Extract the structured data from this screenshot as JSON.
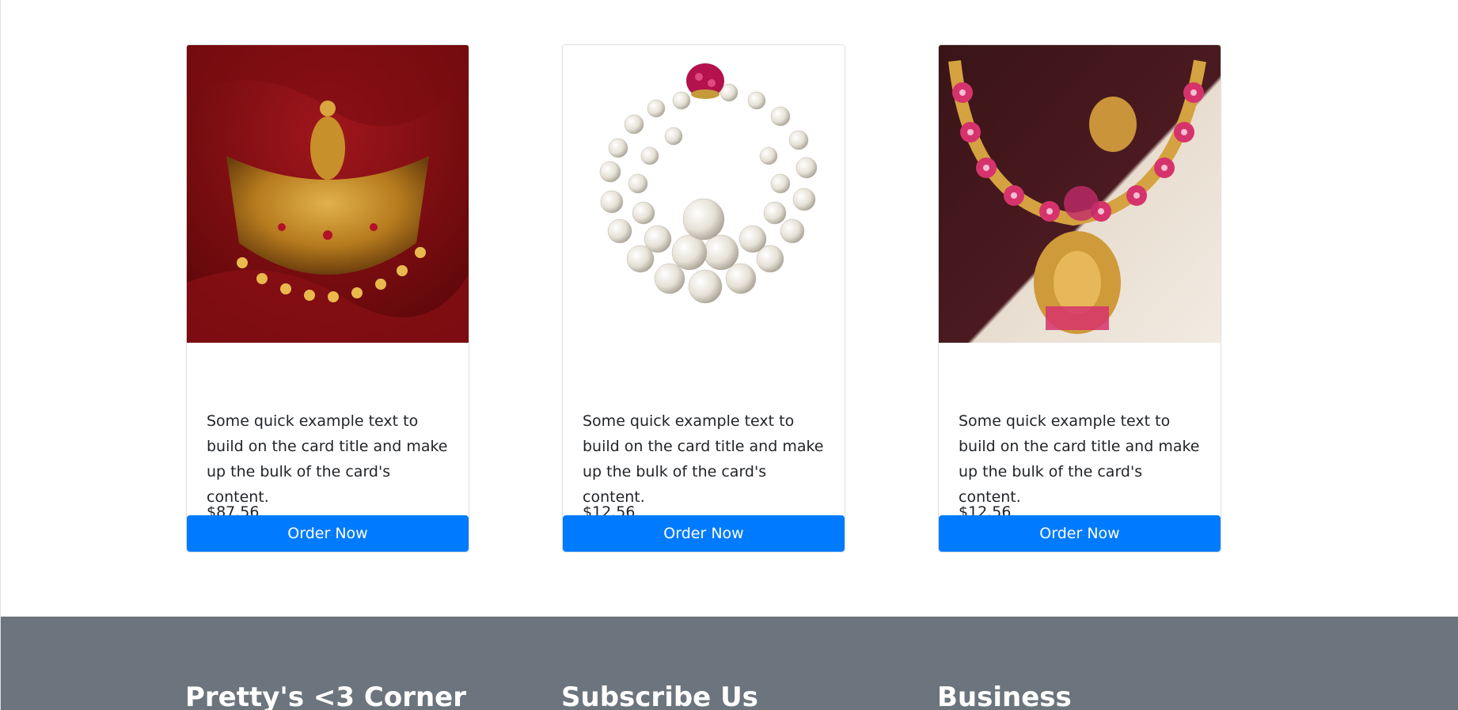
{
  "products": [
    {
      "image_alt": "gold-bridal-necklace",
      "description": "Some quick example text to build on the card title and make up the bulk of the card's content.",
      "price": "$87.56",
      "button_label": "Order Now"
    },
    {
      "image_alt": "pearl-necklace",
      "description": "Some quick example text to build on the card title and make up the bulk of the card's content.",
      "price": "$12.56",
      "button_label": "Order Now"
    },
    {
      "image_alt": "pink-stone-temple-necklace",
      "description": "Some quick example text to build on the card title and make up the bulk of the card's content.",
      "price": "$12.56",
      "button_label": "Order Now"
    }
  ],
  "footer": {
    "col1_title": "Pretty's <3 Corner",
    "col2_title": "Subscribe Us",
    "col3_title": "Business"
  },
  "colors": {
    "button": "#007bff",
    "footer_bg": "#6c757d"
  }
}
